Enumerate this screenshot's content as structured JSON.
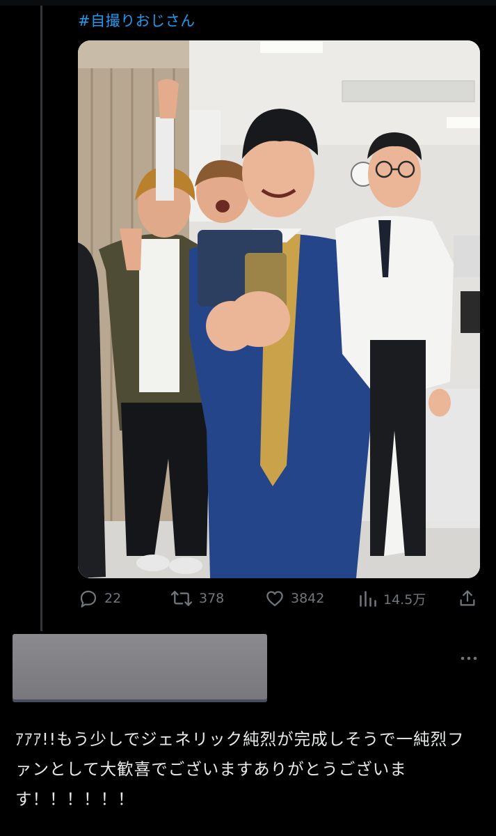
{
  "tweet": {
    "hashtag": "#自撮りおじさん",
    "photo_alt": "",
    "actions": {
      "replies": "22",
      "reposts": "378",
      "likes": "3842",
      "views": "14.5万"
    }
  },
  "reply": {
    "text": "ｱｱｱ!!もう少しでジェネリック純烈が完成しそうで一純烈ファンとして大歓喜でございますありがとうございます！！！！！！"
  },
  "icons": [
    "comment-icon",
    "repost-icon",
    "like-icon",
    "views-icon",
    "share-icon",
    "more-icon"
  ],
  "colors": {
    "background": "#000000",
    "link": "#1d9bf0",
    "muted": "#71767b",
    "text": "#e7e9ea",
    "redaction": "#838387"
  }
}
